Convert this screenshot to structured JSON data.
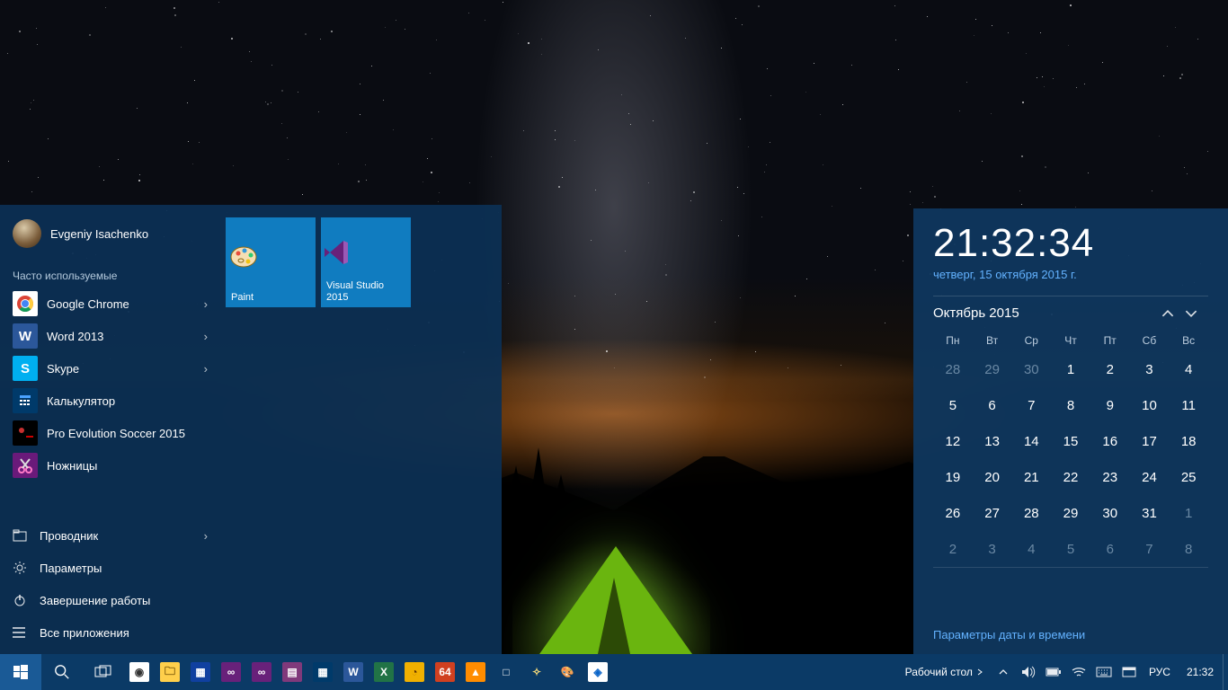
{
  "profile": {
    "name": "Evgeniy Isachenko"
  },
  "start": {
    "frequent_label": "Часто используемые",
    "apps": [
      {
        "label": "Google Chrome",
        "icon": "chrome",
        "has_sub": true
      },
      {
        "label": "Word 2013",
        "icon": "word",
        "has_sub": true
      },
      {
        "label": "Skype",
        "icon": "skype",
        "has_sub": true
      },
      {
        "label": "Калькулятор",
        "icon": "calc",
        "has_sub": false
      },
      {
        "label": "Pro Evolution Soccer 2015",
        "icon": "pes",
        "has_sub": false
      },
      {
        "label": "Ножницы",
        "icon": "snip",
        "has_sub": false
      }
    ],
    "system": [
      {
        "label": "Проводник",
        "icon": "explorer",
        "has_sub": true
      },
      {
        "label": "Параметры",
        "icon": "settings",
        "has_sub": false
      },
      {
        "label": "Завершение работы",
        "icon": "power",
        "has_sub": false
      },
      {
        "label": "Все приложения",
        "icon": "allapps",
        "has_sub": false
      }
    ],
    "tiles": [
      {
        "label": "Paint",
        "icon": "paint"
      },
      {
        "label": "Visual Studio 2015",
        "icon": "vs"
      }
    ]
  },
  "calendar": {
    "time": "21:32:34",
    "date_long": "четверг, 15 октября 2015 г.",
    "month_label": "Октябрь 2015",
    "weekdays": [
      "Пн",
      "Вт",
      "Ср",
      "Чт",
      "Пт",
      "Сб",
      "Вс"
    ],
    "weeks": [
      [
        {
          "d": 28,
          "dim": true
        },
        {
          "d": 29,
          "dim": true
        },
        {
          "d": 30,
          "dim": true
        },
        {
          "d": 1
        },
        {
          "d": 2
        },
        {
          "d": 3
        },
        {
          "d": 4
        }
      ],
      [
        {
          "d": 5
        },
        {
          "d": 6
        },
        {
          "d": 7
        },
        {
          "d": 8
        },
        {
          "d": 9
        },
        {
          "d": 10
        },
        {
          "d": 11
        }
      ],
      [
        {
          "d": 12
        },
        {
          "d": 13
        },
        {
          "d": 14
        },
        {
          "d": 15,
          "today": true
        },
        {
          "d": 16
        },
        {
          "d": 17
        },
        {
          "d": 18
        }
      ],
      [
        {
          "d": 19
        },
        {
          "d": 20
        },
        {
          "d": 21
        },
        {
          "d": 22
        },
        {
          "d": 23
        },
        {
          "d": 24
        },
        {
          "d": 25
        }
      ],
      [
        {
          "d": 26
        },
        {
          "d": 27
        },
        {
          "d": 28
        },
        {
          "d": 29
        },
        {
          "d": 30
        },
        {
          "d": 31
        },
        {
          "d": 1,
          "dim": true
        }
      ],
      [
        {
          "d": 2,
          "dim": true
        },
        {
          "d": 3,
          "dim": true
        },
        {
          "d": 4,
          "dim": true
        },
        {
          "d": 5,
          "dim": true
        },
        {
          "d": 6,
          "dim": true
        },
        {
          "d": 7,
          "dim": true
        },
        {
          "d": 8,
          "dim": true
        }
      ]
    ],
    "settings_link": "Параметры даты и времени"
  },
  "taskbar": {
    "pinned": [
      {
        "name": "chrome",
        "bg": "#fff",
        "fg": "#333",
        "glyph": "◉"
      },
      {
        "name": "explorer",
        "bg": "#ffcf4b",
        "fg": "#6a4a00",
        "glyph": "🗀"
      },
      {
        "name": "far",
        "bg": "#1040a0",
        "fg": "#fff",
        "glyph": "▦"
      },
      {
        "name": "visual-studio",
        "bg": "#68217a",
        "fg": "#fff",
        "glyph": "∞"
      },
      {
        "name": "blend",
        "bg": "#68217a",
        "fg": "#fff",
        "glyph": "∞"
      },
      {
        "name": "onenote",
        "bg": "#80397b",
        "fg": "#fff",
        "glyph": "▤"
      },
      {
        "name": "calculator",
        "bg": "#003a6a",
        "fg": "#fff",
        "glyph": "▦"
      },
      {
        "name": "word",
        "bg": "#2b579a",
        "fg": "#fff",
        "glyph": "W"
      },
      {
        "name": "excel",
        "bg": "#217346",
        "fg": "#fff",
        "glyph": "X"
      },
      {
        "name": "app-yellow",
        "bg": "#f0b000",
        "fg": "#603000",
        "glyph": "◔"
      },
      {
        "name": "aida64",
        "bg": "#d04020",
        "fg": "#fff",
        "glyph": "64"
      },
      {
        "name": "vlc",
        "bg": "#ff8c00",
        "fg": "#fff",
        "glyph": "▲"
      },
      {
        "name": "app-square",
        "bg": "#0b3a66",
        "fg": "#fff",
        "glyph": "□"
      },
      {
        "name": "app-tools",
        "bg": "#0b3a66",
        "fg": "#ffe07a",
        "glyph": "✧"
      },
      {
        "name": "paint",
        "bg": "#0b3a66",
        "fg": "#fff",
        "glyph": "🎨"
      },
      {
        "name": "teamviewer",
        "bg": "#fff",
        "fg": "#0a64c8",
        "glyph": "◈"
      }
    ],
    "desktop_label": "Рабочий стол",
    "language": "РУС",
    "clock": "21:32"
  }
}
